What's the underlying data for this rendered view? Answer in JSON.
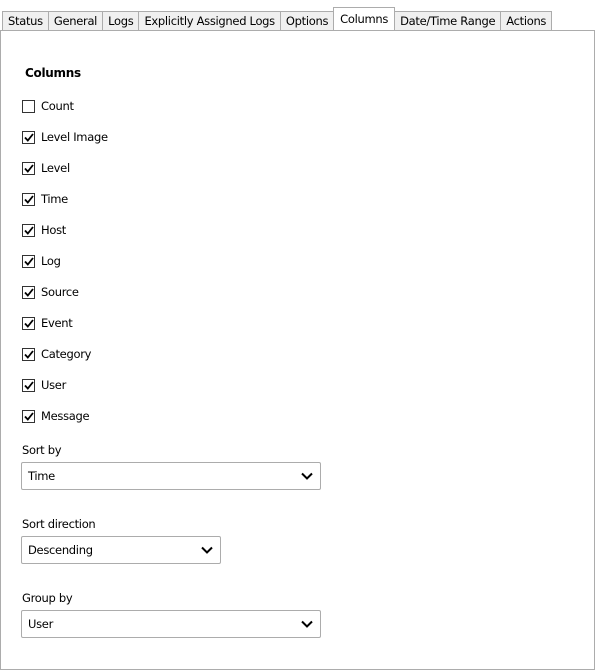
{
  "tabs": [
    {
      "label": "Status",
      "active": false
    },
    {
      "label": "General",
      "active": false
    },
    {
      "label": "Logs",
      "active": false
    },
    {
      "label": "Explicitly Assigned Logs",
      "active": false
    },
    {
      "label": "Options",
      "active": false
    },
    {
      "label": "Columns",
      "active": true
    },
    {
      "label": "Date/Time Range",
      "active": false
    },
    {
      "label": "Actions",
      "active": false
    }
  ],
  "columns": {
    "heading": "Columns",
    "items": [
      {
        "label": "Count",
        "checked": false
      },
      {
        "label": "Level Image",
        "checked": true
      },
      {
        "label": "Level",
        "checked": true
      },
      {
        "label": "Time",
        "checked": true
      },
      {
        "label": "Host",
        "checked": true
      },
      {
        "label": "Log",
        "checked": true
      },
      {
        "label": "Source",
        "checked": true
      },
      {
        "label": "Event",
        "checked": true
      },
      {
        "label": "Category",
        "checked": true
      },
      {
        "label": "User",
        "checked": true
      },
      {
        "label": "Message",
        "checked": true
      }
    ]
  },
  "sort_by": {
    "label": "Sort by",
    "value": "Time"
  },
  "sort_direction": {
    "label": "Sort direction",
    "value": "Descending"
  },
  "group_by": {
    "label": "Group by",
    "value": "User"
  },
  "icons": {
    "checkbox_check": "check-icon",
    "dropdown": "chevron-down-icon"
  }
}
